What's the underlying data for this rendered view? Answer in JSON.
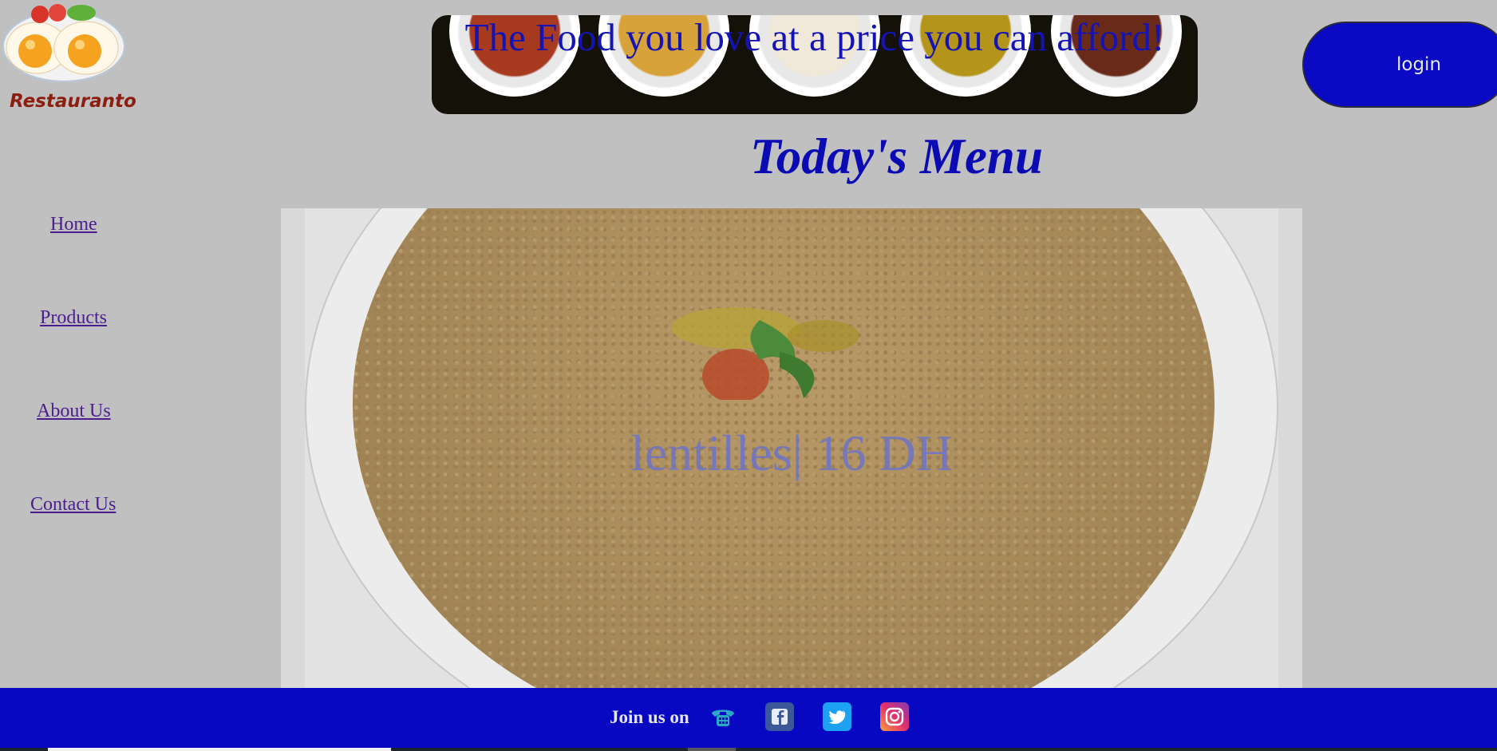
{
  "brand": {
    "name": "Restauranto",
    "logo_icon": "fried-eggs-plate-icon"
  },
  "banner": {
    "tagline": "The Food you love at a price you can afford!",
    "plates": [
      "#a83a1f",
      "#d8a23a",
      "#e8e0d0",
      "#b5941a",
      "#6a2a1a"
    ]
  },
  "login": {
    "label": "login"
  },
  "menu": {
    "title": "Today's Menu",
    "dish_caption": "lentilles| 16 DH"
  },
  "nav": [
    {
      "label": "Home"
    },
    {
      "label": "Products"
    },
    {
      "label": "About Us"
    },
    {
      "label": "Contact Us"
    }
  ],
  "footer": {
    "join_label": "Join us on",
    "icons": [
      "phone-icon",
      "facebook-icon",
      "twitter-icon",
      "instagram-icon"
    ]
  },
  "colors": {
    "accent": "#0808c2",
    "brand_text": "#8b1e0e",
    "link": "#4b1d8f"
  }
}
